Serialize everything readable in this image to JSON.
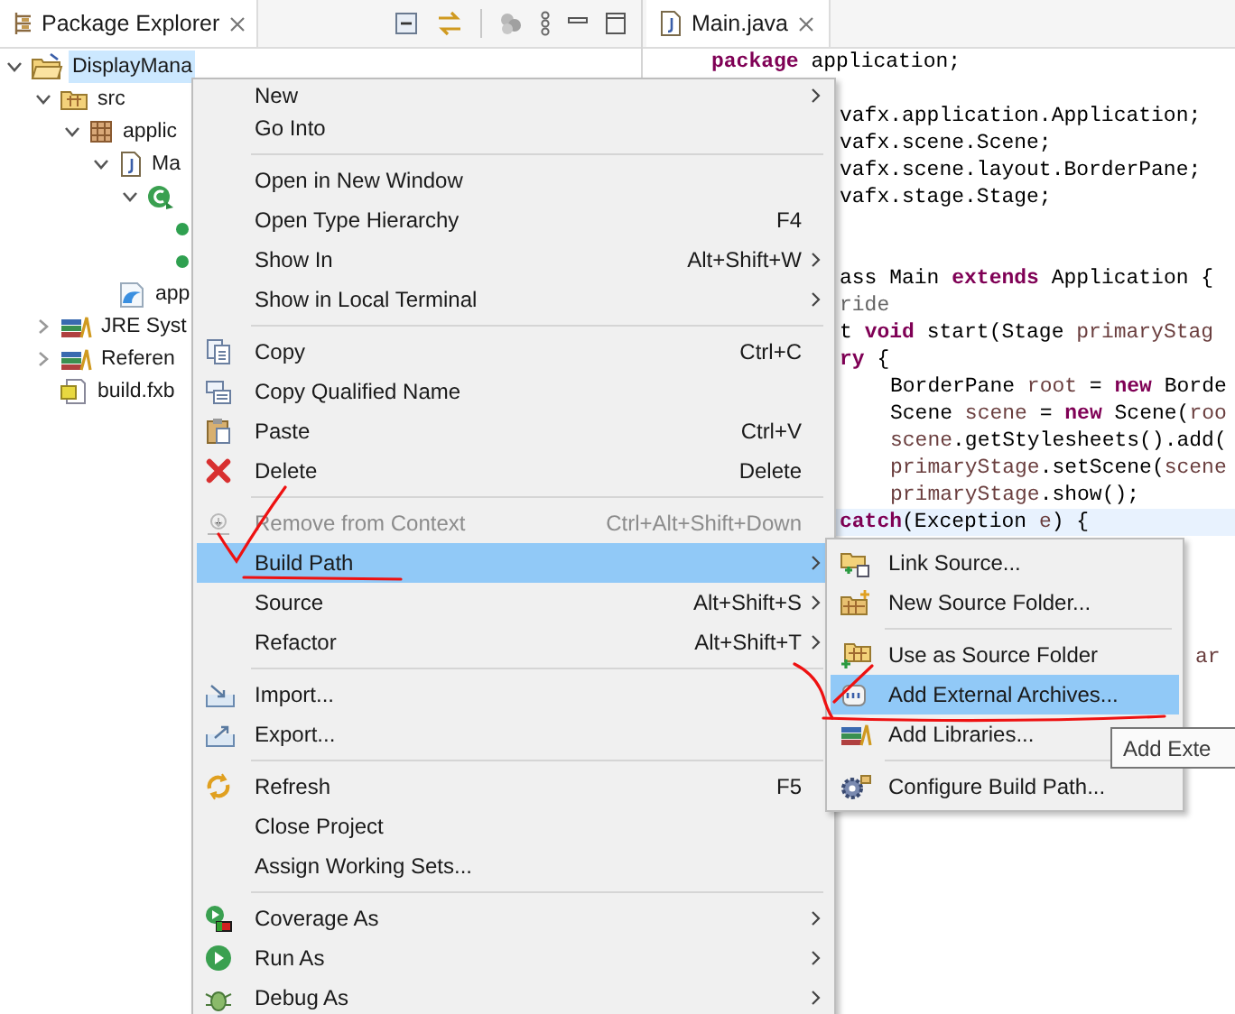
{
  "explorer": {
    "tab": {
      "label": "Package Explorer"
    },
    "tree": [
      {
        "label": "DisplayMana",
        "expanded": true,
        "selected": true,
        "children": [
          {
            "label": "src",
            "expanded": true,
            "selected": false,
            "children": [
              {
                "label": "applic",
                "expanded": true,
                "selected": false,
                "children": [
                  {
                    "label": "Ma",
                    "expanded": true,
                    "selected": false,
                    "children": [
                      {
                        "expanded": true,
                        "children": [
                          {
                            "kind": "leaf"
                          },
                          {
                            "kind": "leaf"
                          }
                        ]
                      }
                    ]
                  },
                  {
                    "label": "app",
                    "selected": false
                  }
                ]
              }
            ]
          },
          {
            "label": "JRE Syst",
            "expanded": false,
            "selected": false
          },
          {
            "label": "Referen",
            "expanded": false,
            "selected": false
          },
          {
            "label": "build.fxb",
            "selected": false
          }
        ]
      }
    ]
  },
  "editor": {
    "tab": {
      "label": "Main.java"
    },
    "lines": [
      {
        "kind": "full",
        "current": false,
        "segments": [
          {
            "text": "package",
            "kind": "keyword"
          },
          {
            "text": " application;",
            "kind": "plain"
          }
        ]
      },
      {
        "kind": "blank",
        "current": false
      },
      {
        "kind": "clipped",
        "current": false,
        "segments": [
          {
            "text": "vafx.application.Application;",
            "kind": "plain"
          }
        ]
      },
      {
        "kind": "clipped",
        "current": false,
        "segments": [
          {
            "text": "vafx.scene.Scene;",
            "kind": "plain"
          }
        ]
      },
      {
        "kind": "clipped",
        "current": false,
        "segments": [
          {
            "text": "vafx.scene.layout.BorderPane;",
            "kind": "plain"
          }
        ]
      },
      {
        "kind": "clipped",
        "current": false,
        "segments": [
          {
            "text": "vafx.stage.Stage;",
            "kind": "plain"
          }
        ]
      },
      {
        "kind": "blank",
        "current": false
      },
      {
        "kind": "blank",
        "current": false
      },
      {
        "kind": "clipped",
        "current": false,
        "segments": [
          {
            "text": "ass Main ",
            "kind": "plain"
          },
          {
            "text": "extends",
            "kind": "keyword"
          },
          {
            "text": " Application {",
            "kind": "plain"
          }
        ]
      },
      {
        "kind": "clipped",
        "current": false,
        "segments": [
          {
            "text": "ride",
            "kind": "annotation"
          }
        ]
      },
      {
        "kind": "clipped",
        "current": false,
        "segments": [
          {
            "text": "t ",
            "kind": "plain"
          },
          {
            "text": "void",
            "kind": "keyword"
          },
          {
            "text": " start(Stage ",
            "kind": "plain"
          },
          {
            "text": "primaryStag",
            "kind": "variable"
          }
        ]
      },
      {
        "kind": "clipped",
        "current": false,
        "segments": [
          {
            "text": "ry",
            "kind": "keyword"
          },
          {
            "text": " {",
            "kind": "plain"
          }
        ]
      },
      {
        "kind": "indented",
        "current": false,
        "segments": [
          {
            "text": "BorderPane ",
            "kind": "plain"
          },
          {
            "text": "root",
            "kind": "variable"
          },
          {
            "text": " = ",
            "kind": "plain"
          },
          {
            "text": "new",
            "kind": "keyword"
          },
          {
            "text": " Borde",
            "kind": "plain"
          }
        ]
      },
      {
        "kind": "indented",
        "current": false,
        "segments": [
          {
            "text": "Scene ",
            "kind": "plain"
          },
          {
            "text": "scene",
            "kind": "variable"
          },
          {
            "text": " = ",
            "kind": "plain"
          },
          {
            "text": "new",
            "kind": "keyword"
          },
          {
            "text": " Scene(",
            "kind": "plain"
          },
          {
            "text": "roo",
            "kind": "variable"
          }
        ]
      },
      {
        "kind": "indented",
        "current": false,
        "segments": [
          {
            "text": "scene",
            "kind": "variable"
          },
          {
            "text": ".getStylesheets().add(",
            "kind": "plain"
          }
        ]
      },
      {
        "kind": "indented",
        "current": false,
        "segments": [
          {
            "text": "primaryStage",
            "kind": "variable"
          },
          {
            "text": ".setScene(",
            "kind": "plain"
          },
          {
            "text": "scene",
            "kind": "variable"
          }
        ]
      },
      {
        "kind": "indented",
        "current": false,
        "segments": [
          {
            "text": "primaryStage",
            "kind": "variable"
          },
          {
            "text": ".show();",
            "kind": "plain"
          }
        ]
      },
      {
        "kind": "clipped",
        "current": true,
        "segments": [
          {
            "text": "catch",
            "kind": "keyword"
          },
          {
            "text": "(Exception ",
            "kind": "plain"
          },
          {
            "text": "e",
            "kind": "variable"
          },
          {
            "text": ") {",
            "kind": "plain"
          }
        ]
      },
      {
        "kind": "blank",
        "current": false
      },
      {
        "kind": "blank",
        "current": false
      },
      {
        "kind": "blank",
        "current": false
      },
      {
        "kind": "blank",
        "current": false
      },
      {
        "kind": "edge",
        "current": false,
        "segments": [
          {
            "text": "ar",
            "kind": "variable"
          }
        ]
      }
    ]
  },
  "context_menu": [
    {
      "kind": "item",
      "label": "New",
      "has_submenu": true,
      "disabled": false,
      "selected": false
    },
    {
      "kind": "item",
      "label": "Go Into",
      "has_submenu": false,
      "disabled": false,
      "selected": false
    },
    {
      "kind": "separator"
    },
    {
      "kind": "item",
      "label": "Open in New Window",
      "has_submenu": false,
      "disabled": false,
      "selected": false
    },
    {
      "kind": "item",
      "label": "Open Type Hierarchy",
      "shortcut": "F4",
      "has_submenu": false,
      "disabled": false,
      "selected": false
    },
    {
      "kind": "item",
      "label": "Show In",
      "shortcut": "Alt+Shift+W",
      "has_submenu": true,
      "disabled": false,
      "selected": false
    },
    {
      "kind": "item",
      "label": "Show in Local Terminal",
      "has_submenu": true,
      "disabled": false,
      "selected": false
    },
    {
      "kind": "separator"
    },
    {
      "kind": "item",
      "label": "Copy",
      "shortcut": "Ctrl+C",
      "has_submenu": false,
      "disabled": false,
      "selected": false
    },
    {
      "kind": "item",
      "label": "Copy Qualified Name",
      "has_submenu": false,
      "disabled": false,
      "selected": false
    },
    {
      "kind": "item",
      "label": "Paste",
      "shortcut": "Ctrl+V",
      "has_submenu": false,
      "disabled": false,
      "selected": false
    },
    {
      "kind": "item",
      "label": "Delete",
      "shortcut": "Delete",
      "has_submenu": false,
      "disabled": false,
      "selected": false
    },
    {
      "kind": "separator"
    },
    {
      "kind": "item",
      "label": "Remove from Context",
      "shortcut": "Ctrl+Alt+Shift+Down",
      "has_submenu": false,
      "disabled": true,
      "selected": false
    },
    {
      "kind": "item",
      "label": "Build Path",
      "has_submenu": true,
      "disabled": false,
      "selected": true
    },
    {
      "kind": "item",
      "label": "Source",
      "shortcut": "Alt+Shift+S",
      "has_submenu": true,
      "disabled": false,
      "selected": false
    },
    {
      "kind": "item",
      "label": "Refactor",
      "shortcut": "Alt+Shift+T",
      "has_submenu": true,
      "disabled": false,
      "selected": false
    },
    {
      "kind": "separator"
    },
    {
      "kind": "item",
      "label": "Import...",
      "has_submenu": false,
      "disabled": false,
      "selected": false
    },
    {
      "kind": "item",
      "label": "Export...",
      "has_submenu": false,
      "disabled": false,
      "selected": false
    },
    {
      "kind": "separator"
    },
    {
      "kind": "item",
      "label": "Refresh",
      "shortcut": "F5",
      "has_submenu": false,
      "disabled": false,
      "selected": false
    },
    {
      "kind": "item",
      "label": "Close Project",
      "has_submenu": false,
      "disabled": false,
      "selected": false
    },
    {
      "kind": "item",
      "label": "Assign Working Sets...",
      "has_submenu": false,
      "disabled": false,
      "selected": false
    },
    {
      "kind": "separator"
    },
    {
      "kind": "item",
      "label": "Coverage As",
      "has_submenu": true,
      "disabled": false,
      "selected": false
    },
    {
      "kind": "item",
      "label": "Run As",
      "has_submenu": true,
      "disabled": false,
      "selected": false
    },
    {
      "kind": "item",
      "label": "Debug As",
      "has_submenu": true,
      "disabled": false,
      "selected": false
    }
  ],
  "build_path_submenu": [
    {
      "kind": "item",
      "label": "Link Source...",
      "selected": false
    },
    {
      "kind": "item",
      "label": "New Source Folder...",
      "selected": false
    },
    {
      "kind": "separator"
    },
    {
      "kind": "item",
      "label": "Use as Source Folder",
      "selected": false
    },
    {
      "kind": "item",
      "label": "Add External Archives...",
      "selected": true
    },
    {
      "kind": "item",
      "label": "Add Libraries...",
      "selected": false
    },
    {
      "kind": "separator"
    },
    {
      "kind": "item",
      "label": "Configure Build Path...",
      "selected": false
    }
  ],
  "tooltip": {
    "text": "Add Exte"
  }
}
